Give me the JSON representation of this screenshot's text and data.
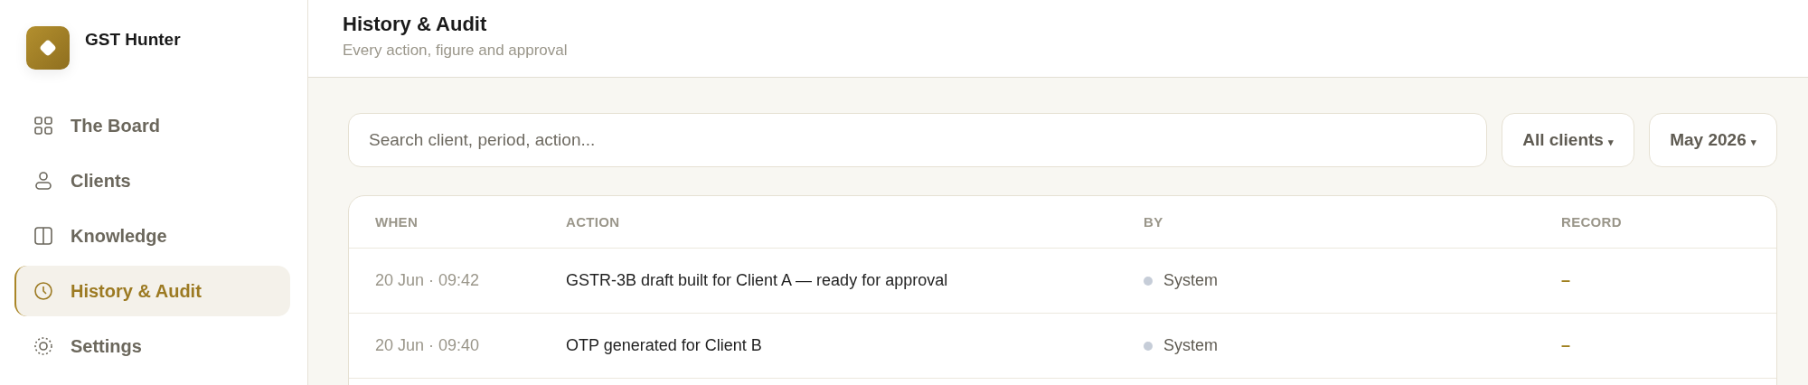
{
  "app": {
    "name": "GST Hunter"
  },
  "sidebar": {
    "items": [
      {
        "label": "The Board",
        "selected": false
      },
      {
        "label": "Clients",
        "selected": false
      },
      {
        "label": "Knowledge",
        "selected": false
      },
      {
        "label": "History & Audit",
        "selected": true
      },
      {
        "label": "Settings",
        "selected": false
      }
    ]
  },
  "header": {
    "title": "History & Audit",
    "subtitle": "Every action, figure and approval"
  },
  "search": {
    "placeholder": "Search client, period, action..."
  },
  "filters": [
    {
      "label": "All clients",
      "caret": "▾"
    },
    {
      "label": "May 2026",
      "caret": "▾"
    }
  ],
  "table": {
    "columns": [
      "WHEN",
      "ACTION",
      "BY",
      "RECORD"
    ],
    "rows": [
      {
        "when": "20 Jun · 09:42",
        "action": "GSTR-3B draft built for Client A — ready for approval",
        "by": "System",
        "color": "#c6cdd8",
        "record": "–"
      },
      {
        "when": "20 Jun · 09:40",
        "action": "OTP generated for Client B",
        "by": "System",
        "color": "#c6cdd8",
        "record": "–"
      }
    ]
  }
}
